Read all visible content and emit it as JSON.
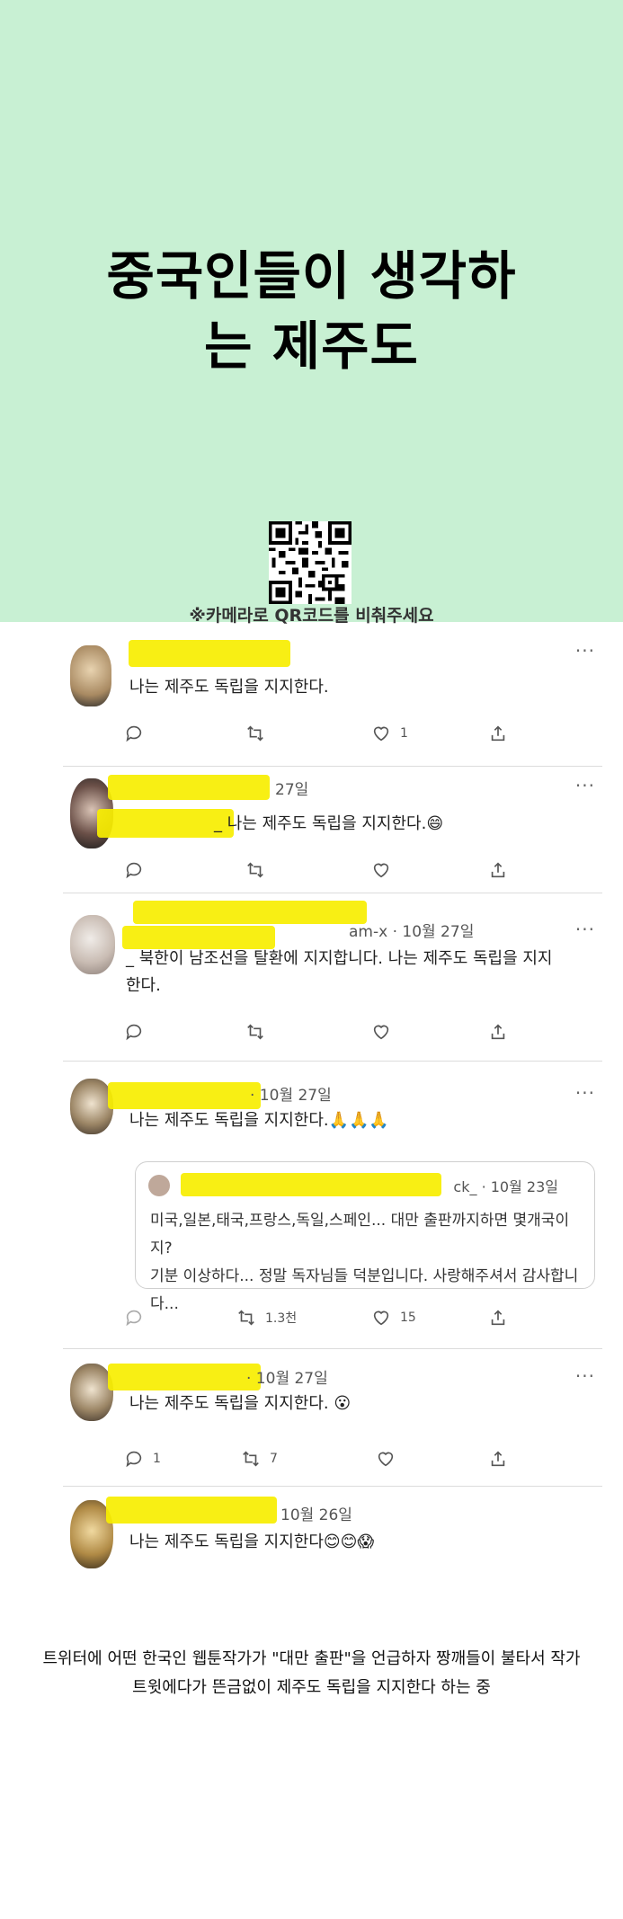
{
  "header": {
    "title_line1": "중국인들이 생각하",
    "title_line2": "는 제주도",
    "qr_caption": "※카메라로 QR코드를 비춰주세요"
  },
  "tweets": [
    {
      "meta": "",
      "text": "나는 제주도 독립을 지지한다.",
      "reply": "",
      "retweet": "",
      "like": "1"
    },
    {
      "meta": "27일",
      "text": "_ 나는 제주도 독립을 지지한다.😄",
      "reply": "",
      "retweet": "",
      "like": ""
    },
    {
      "meta": "am-x · 10월 27일",
      "text_line1": "_ 북한이 남조선을 탈환에 지지합니다. 나는 제주도 독립을 지지",
      "text_line2": "한다.",
      "reply": "",
      "retweet": "",
      "like": ""
    },
    {
      "meta": "· 10월 27일",
      "text": "나는 제주도 독립을 지지한다.🙏🙏🙏",
      "reply": "",
      "retweet": "1.3천",
      "like": "15"
    },
    {
      "meta": "· 10월 27일",
      "text": "나는 제주도 독립을 지지한다. 😮",
      "reply": "1",
      "retweet": "7",
      "like": ""
    },
    {
      "meta": "10월 26일",
      "text": "나는 제주도 독립을 지지한다😊😊😱",
      "reply": "",
      "retweet": "",
      "like": ""
    }
  ],
  "quote": {
    "meta": "ck_ · 10월 23일",
    "line1": "미국,일본,태국,프랑스,독일,스페인... 대만 출판까지하면 몇개국이지?",
    "line2": "기분 이상하다... 정말 독자님들 덕분입니다. 사랑해주셔서 감사합니다..."
  },
  "caption": {
    "line1": "트위터에 어떤 한국인 웹툰작가가 \"대만 출판\"을 언급하자 짱깨들이 불타서 작가",
    "line2": "트윗에다가 뜬금없이 제주도 독립을 지지한다 하는 중"
  },
  "more_label": "···",
  "colors": {
    "header_bg": "#c8f0d3",
    "highlight": "#f7ee00"
  }
}
